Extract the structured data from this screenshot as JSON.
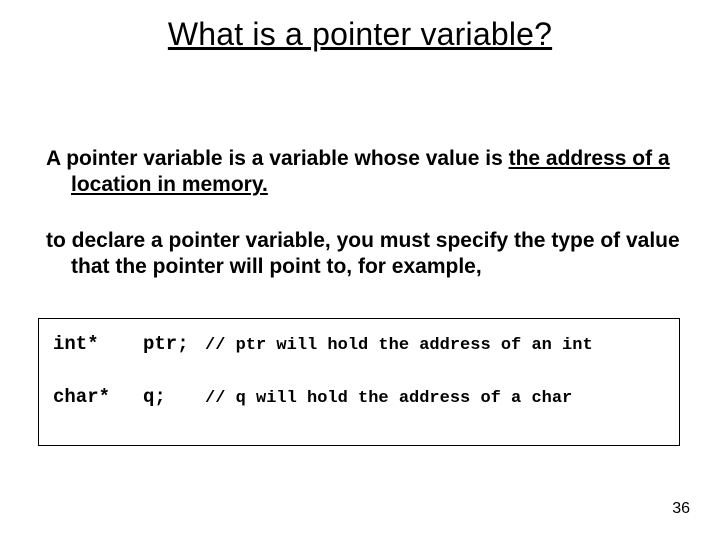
{
  "title": "What is a pointer variable?",
  "para1_lead": "A pointer variable is a variable whose value is ",
  "para1_underlined": "the address of a location in memory.",
  "para2": "to declare a pointer variable, you must specify the type of value that the pointer will point to, for example,",
  "code": {
    "row1": {
      "type": "int*",
      "var": "ptr;",
      "comment": "// ptr will hold the address of an int"
    },
    "row2": {
      "type": "char*",
      "var": "q;",
      "comment": "// q will hold the address of a char"
    }
  },
  "page_number": "36"
}
